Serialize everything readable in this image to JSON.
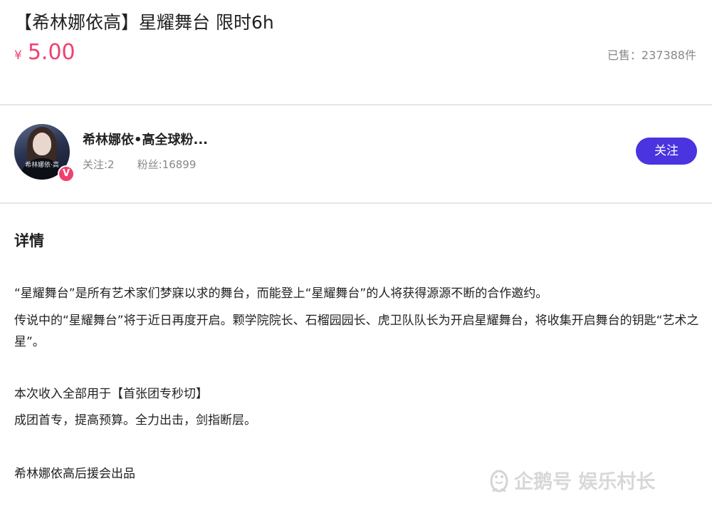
{
  "product": {
    "title": "【希林娜依高】星耀舞台 限时6h",
    "currency_symbol": "¥",
    "price": "5.00",
    "sold_text": "已售：237388件"
  },
  "author": {
    "avatar_caption": "希林娜依·高",
    "badge": "V",
    "name": "希林娜依•高全球粉...",
    "following": "关注:2",
    "fans": "粉丝:16899",
    "follow_label": "关注"
  },
  "detail": {
    "heading": "详情",
    "paragraphs": [
      "“星耀舞台”是所有艺术家们梦寐以求的舞台，而能登上“星耀舞台”的人将获得源源不断的合作邀约。",
      "传说中的“星耀舞台”将于近日再度开启。颗学院院长、石榴园园长、虎卫队队长为开启星耀舞台，将收集开启舞台的钥匙“艺术之星”。",
      "本次收入全部用于【首张团专秒切】",
      "成团首专，提高预算。全力出击，剑指断层。",
      "希林娜依高后援会出品"
    ]
  },
  "watermark": {
    "text": "企鹅号 娱乐村长",
    "icon": "penguin-icon"
  },
  "colors": {
    "price": "#f0406f",
    "follow_button": "#4a34e0",
    "muted": "#888888",
    "divider": "#e6e6e6"
  }
}
